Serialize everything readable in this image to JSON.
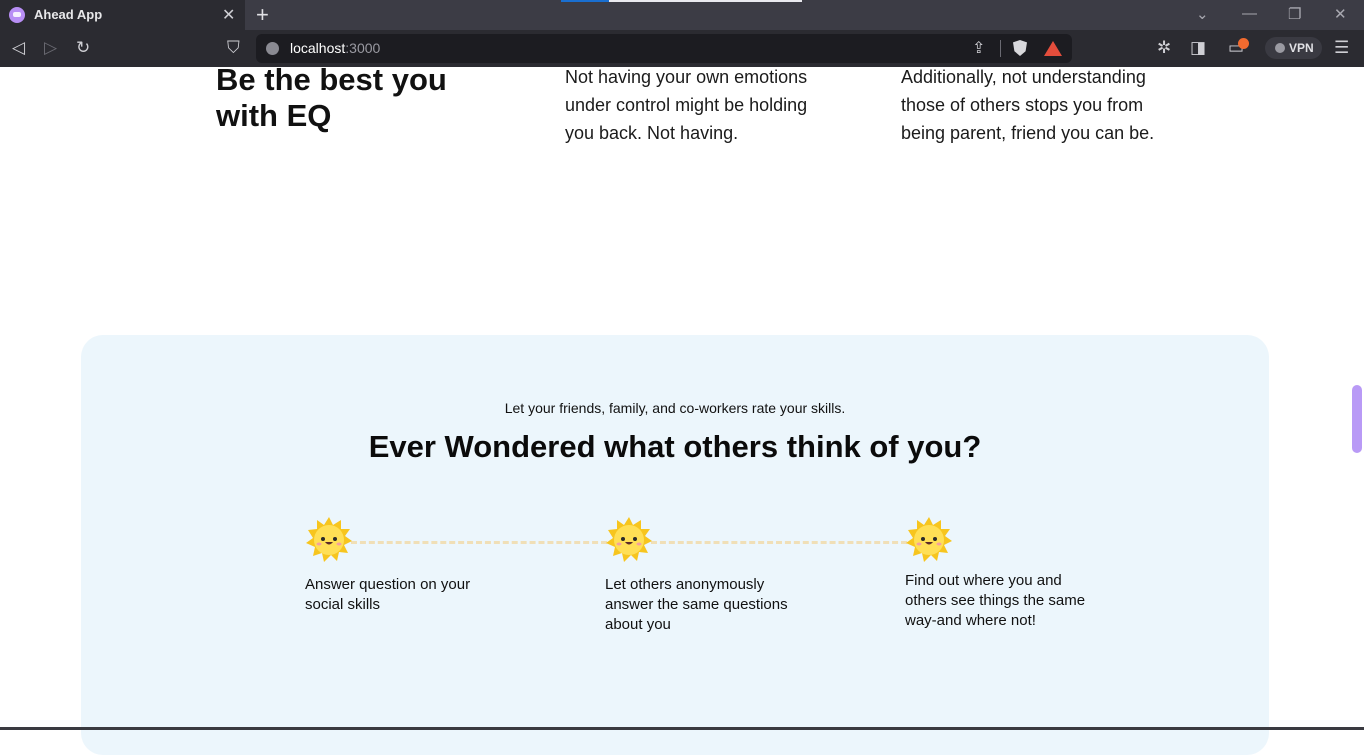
{
  "browser": {
    "tab_title": "Ahead App",
    "tab_close_glyph": "✕",
    "new_tab_glyph": "+",
    "url_host": "localhost",
    "url_port": ":3000",
    "vpn_label": "VPN",
    "icons": [
      "back-icon",
      "forward-icon",
      "reload-icon",
      "bookmark-icon",
      "share-icon",
      "brave-shield-icon",
      "brave-rewards-icon",
      "extensions-icon",
      "sidebar-icon",
      "wallet-icon",
      "menu-icon"
    ],
    "accent_colors": {
      "tab_indicator_blue": "#1a6fd0",
      "tab_indicator_white": "#e9e9ee"
    }
  },
  "intro": {
    "heading": "Be the best you with EQ",
    "col1": "Not having your own emotions under control might be holding you back. Not having.",
    "col2": "Additionally, not understanding those of others stops you from being parent, friend you can be."
  },
  "section": {
    "kicker": "Let your friends, family, and co-workers rate your skills.",
    "title": "Ever Wondered what others think of you?",
    "steps": [
      {
        "icon": "sun-face-icon",
        "text": "Answer question on your social skills"
      },
      {
        "icon": "sun-face-icon",
        "text": "Let others anonymously answer the same questions about you"
      },
      {
        "icon": "sun-face-icon",
        "text": "Find out where you and others see things the same way-and where not!"
      }
    ],
    "colors": {
      "panel_bg": "#ecf6fc",
      "connector": "#f0dfb7",
      "sun": "#f9c623"
    }
  }
}
